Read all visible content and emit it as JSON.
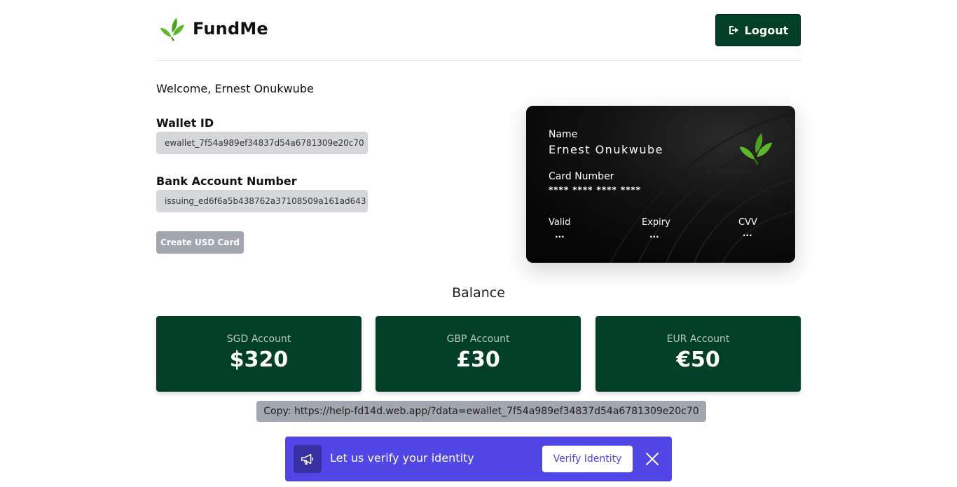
{
  "header": {
    "brand_name": "FundMe",
    "logout_label": "Logout"
  },
  "welcome": "Welcome, Ernest Onukwube",
  "wallet": {
    "label": "Wallet ID",
    "value": "ewallet_7f54a989ef34837d54a6781309e20c70"
  },
  "bank": {
    "label": "Bank Account Number",
    "value": "issuing_ed6f6a5b438762a37108509a161ad643"
  },
  "create_card_label": "Create USD Card",
  "card": {
    "name_label": "Name",
    "name_value": "Ernest Onukwube",
    "number_label": "Card Number",
    "number_value": "**** **** **** ****",
    "valid_label": "Valid",
    "valid_value": "...",
    "expiry_label": "Expiry",
    "expiry_value": "...",
    "cvv_label": "CVV",
    "cvv_value": "..."
  },
  "balance": {
    "title": "Balance",
    "accounts": [
      {
        "label": "SGD Account",
        "value": "$320"
      },
      {
        "label": "GBP Account",
        "value": "£30"
      },
      {
        "label": "EUR Account",
        "value": "€50"
      }
    ]
  },
  "copy_text": "Copy: https://help-fd14d.web.app/?data=ewallet_7f54a989ef34837d54a6781309e20c70",
  "banner": {
    "text": "Let us verify your identity",
    "verify_label": "Verify Identity"
  },
  "colors": {
    "brand_green": "#013f26",
    "leaf_green": "#5cb82a",
    "banner_indigo": "#4f46e5",
    "pill_gray": "#d6d7da"
  },
  "icons": {
    "logo": "leaf-icon",
    "logout": "logout-icon",
    "banner": "megaphone-icon",
    "close": "close-icon"
  }
}
